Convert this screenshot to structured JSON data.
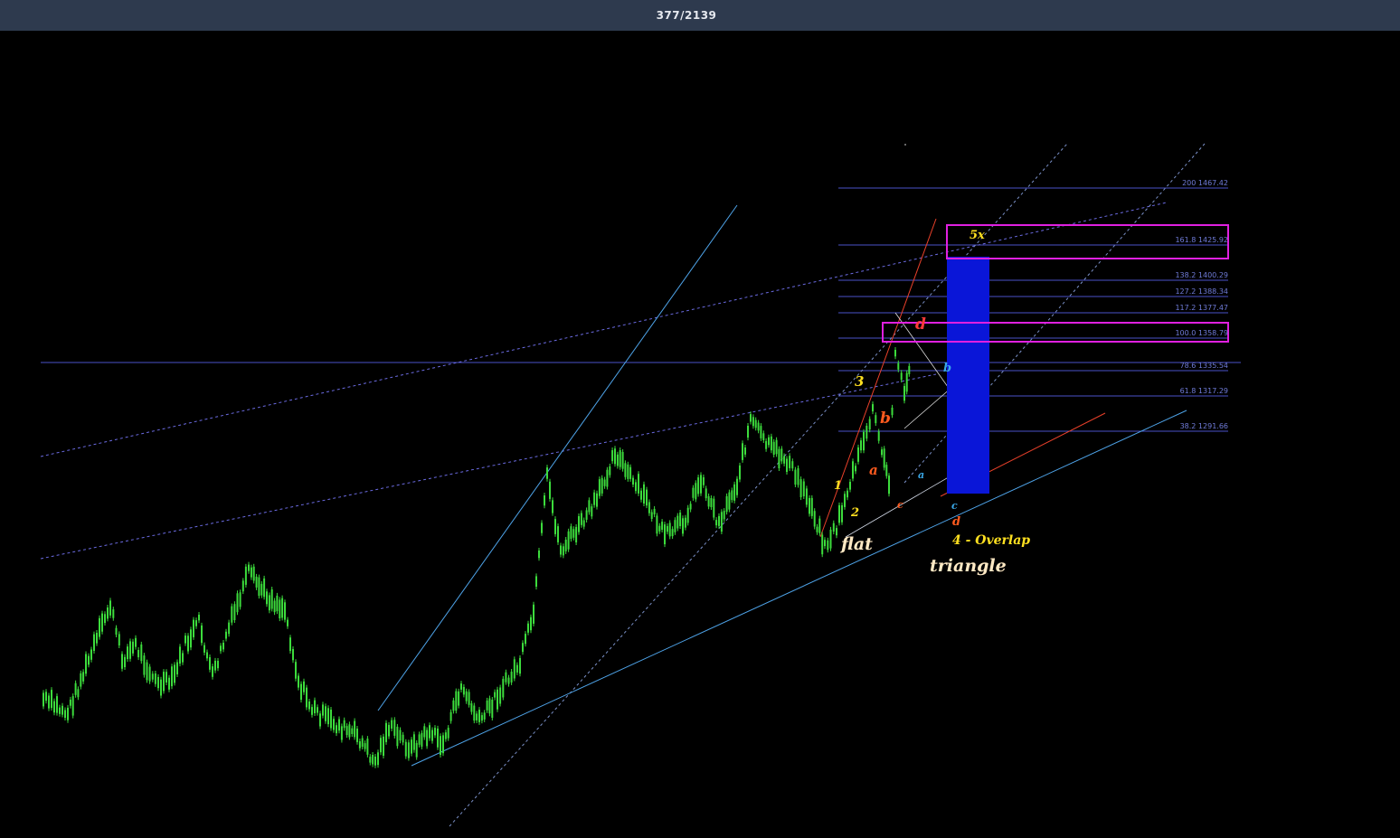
{
  "header": {
    "counter": "377/2139"
  },
  "colors": {
    "background": "#000000",
    "header_bg": "#2e3a4e",
    "candle": "#3cdc3c",
    "fib_line": "#4a52c8",
    "fib_text": "#6f7bd8",
    "channel_blue": "#4ea3e8",
    "dashed_channel": "#6a6ae0",
    "red_line": "#e8402a",
    "magenta_box": "#e020e0",
    "target_zone": "#0a16d8",
    "yellow_label": "#ffe020",
    "orange_label": "#ff5a1e",
    "cyan_label": "#3aa8e8",
    "cream_label": "#ffe9c4"
  },
  "fib_levels": [
    {
      "text": "200 1467.42"
    },
    {
      "text": "161.8 1425.92"
    },
    {
      "text": "138.2 1400.29"
    },
    {
      "text": "127.2 1388.34"
    },
    {
      "text": "117.2 1377.47"
    },
    {
      "text": "100.0   1358.79"
    },
    {
      "text": "78.6 1335.54"
    },
    {
      "text": "61.8 1317.29"
    },
    {
      "text": "38.2 1291.66"
    }
  ],
  "wave_labels": {
    "w1": "1",
    "w2": "2",
    "w3": "3",
    "w5x": "5x",
    "a_red": "a",
    "b_red": "b",
    "c_red": "c",
    "d_red_top": "d",
    "a_cyan": "a",
    "b_cyan": "b",
    "c_cyan": "c",
    "d_red_low": "d",
    "flat": "flat",
    "overlap": "4 - Overlap",
    "triangle": "triangle"
  },
  "icons": {
    "cursor_mark": "crosshair-dot-icon"
  }
}
